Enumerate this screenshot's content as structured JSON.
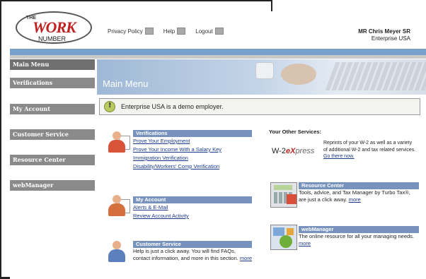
{
  "logo": {
    "the": "THE",
    "work": "WORK",
    "number": "NUMBER"
  },
  "topnav": {
    "privacy": "Privacy Policy",
    "help": "Help",
    "logout": "Logout"
  },
  "user": {
    "name": "MR Chris Meyer SR",
    "company": "Enterprise USA"
  },
  "sidebar": {
    "items": [
      {
        "label": "Main Menu"
      },
      {
        "label": "Verifications"
      },
      {
        "label": "My Account"
      },
      {
        "label": "Customer Service"
      },
      {
        "label": "Resource Center"
      },
      {
        "label": "webManager"
      }
    ]
  },
  "banner": {
    "title": "Main Menu"
  },
  "notice": {
    "text": "Enterprise USA is a demo employer."
  },
  "verifications": {
    "header": "Verifications",
    "links": [
      "Prove Your Employment",
      "Prove Your Income With a Salary Key",
      "Immigration Verification",
      "Disability/Workers' Comp Verification"
    ]
  },
  "my_account": {
    "header": "My Account",
    "links": [
      "Alerts & E-Mail",
      "Review Account Activity"
    ]
  },
  "customer_service": {
    "header": "Customer Service",
    "text": "Help is just a click away. You will find FAQs, contact information, and more in this section.",
    "more": "more"
  },
  "other_services": {
    "title": "Your Other Services:",
    "w2_prefix": "W-2",
    "w2_e": "e",
    "w2_x": "X",
    "w2_press": "press",
    "desc": "Reprints of your W-2 as well as a variety of additional W-2 and tax related services.",
    "go": "Go there now."
  },
  "resource_center": {
    "header": "Resource Center",
    "text": "Tools, advice, and Tax Manager by Turbo Tax®, are just a click away.",
    "more": "more"
  },
  "web_manager": {
    "header": "webManager",
    "text": "The online resource for all your managing needs.",
    "more": "more"
  }
}
